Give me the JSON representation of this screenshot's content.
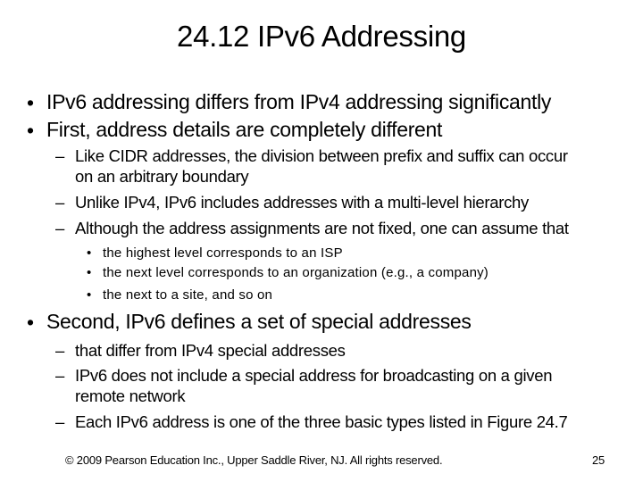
{
  "slide": {
    "title": "24.12  IPv6 Addressing",
    "bullet_glyph": "•",
    "dash_glyph": "–",
    "items": [
      {
        "text": "IPv6 addressing differs from IPv4 addressing significantly"
      },
      {
        "text": "First, address details are completely different",
        "sub": [
          {
            "line1": "Like CIDR addresses, the division between prefix and suffix can occur",
            "line2": "on an arbitrary boundary"
          },
          {
            "line1": "Unlike IPv4, IPv6 includes addresses with a multi-level hierarchy"
          },
          {
            "line1": "Although the address assignments are not fixed, one can assume that",
            "sub": [
              "the highest level corresponds to an ISP",
              "the next level corresponds to an organization (e.g., a company)",
              "the next to a site, and so on"
            ]
          }
        ]
      },
      {
        "text": "Second, IPv6 defines a set of special addresses",
        "sub": [
          {
            "line1": "that differ from IPv4 special addresses"
          },
          {
            "line1": "IPv6 does not include a special address for broadcasting on a given",
            "line2": "remote network"
          },
          {
            "line1": "Each IPv6 address is one of the three basic types listed in Figure 24.7"
          }
        ]
      }
    ]
  },
  "footer": {
    "copyright": "© 2009 Pearson Education Inc., Upper Saddle River, NJ. All rights reserved.",
    "page_number": "25"
  }
}
